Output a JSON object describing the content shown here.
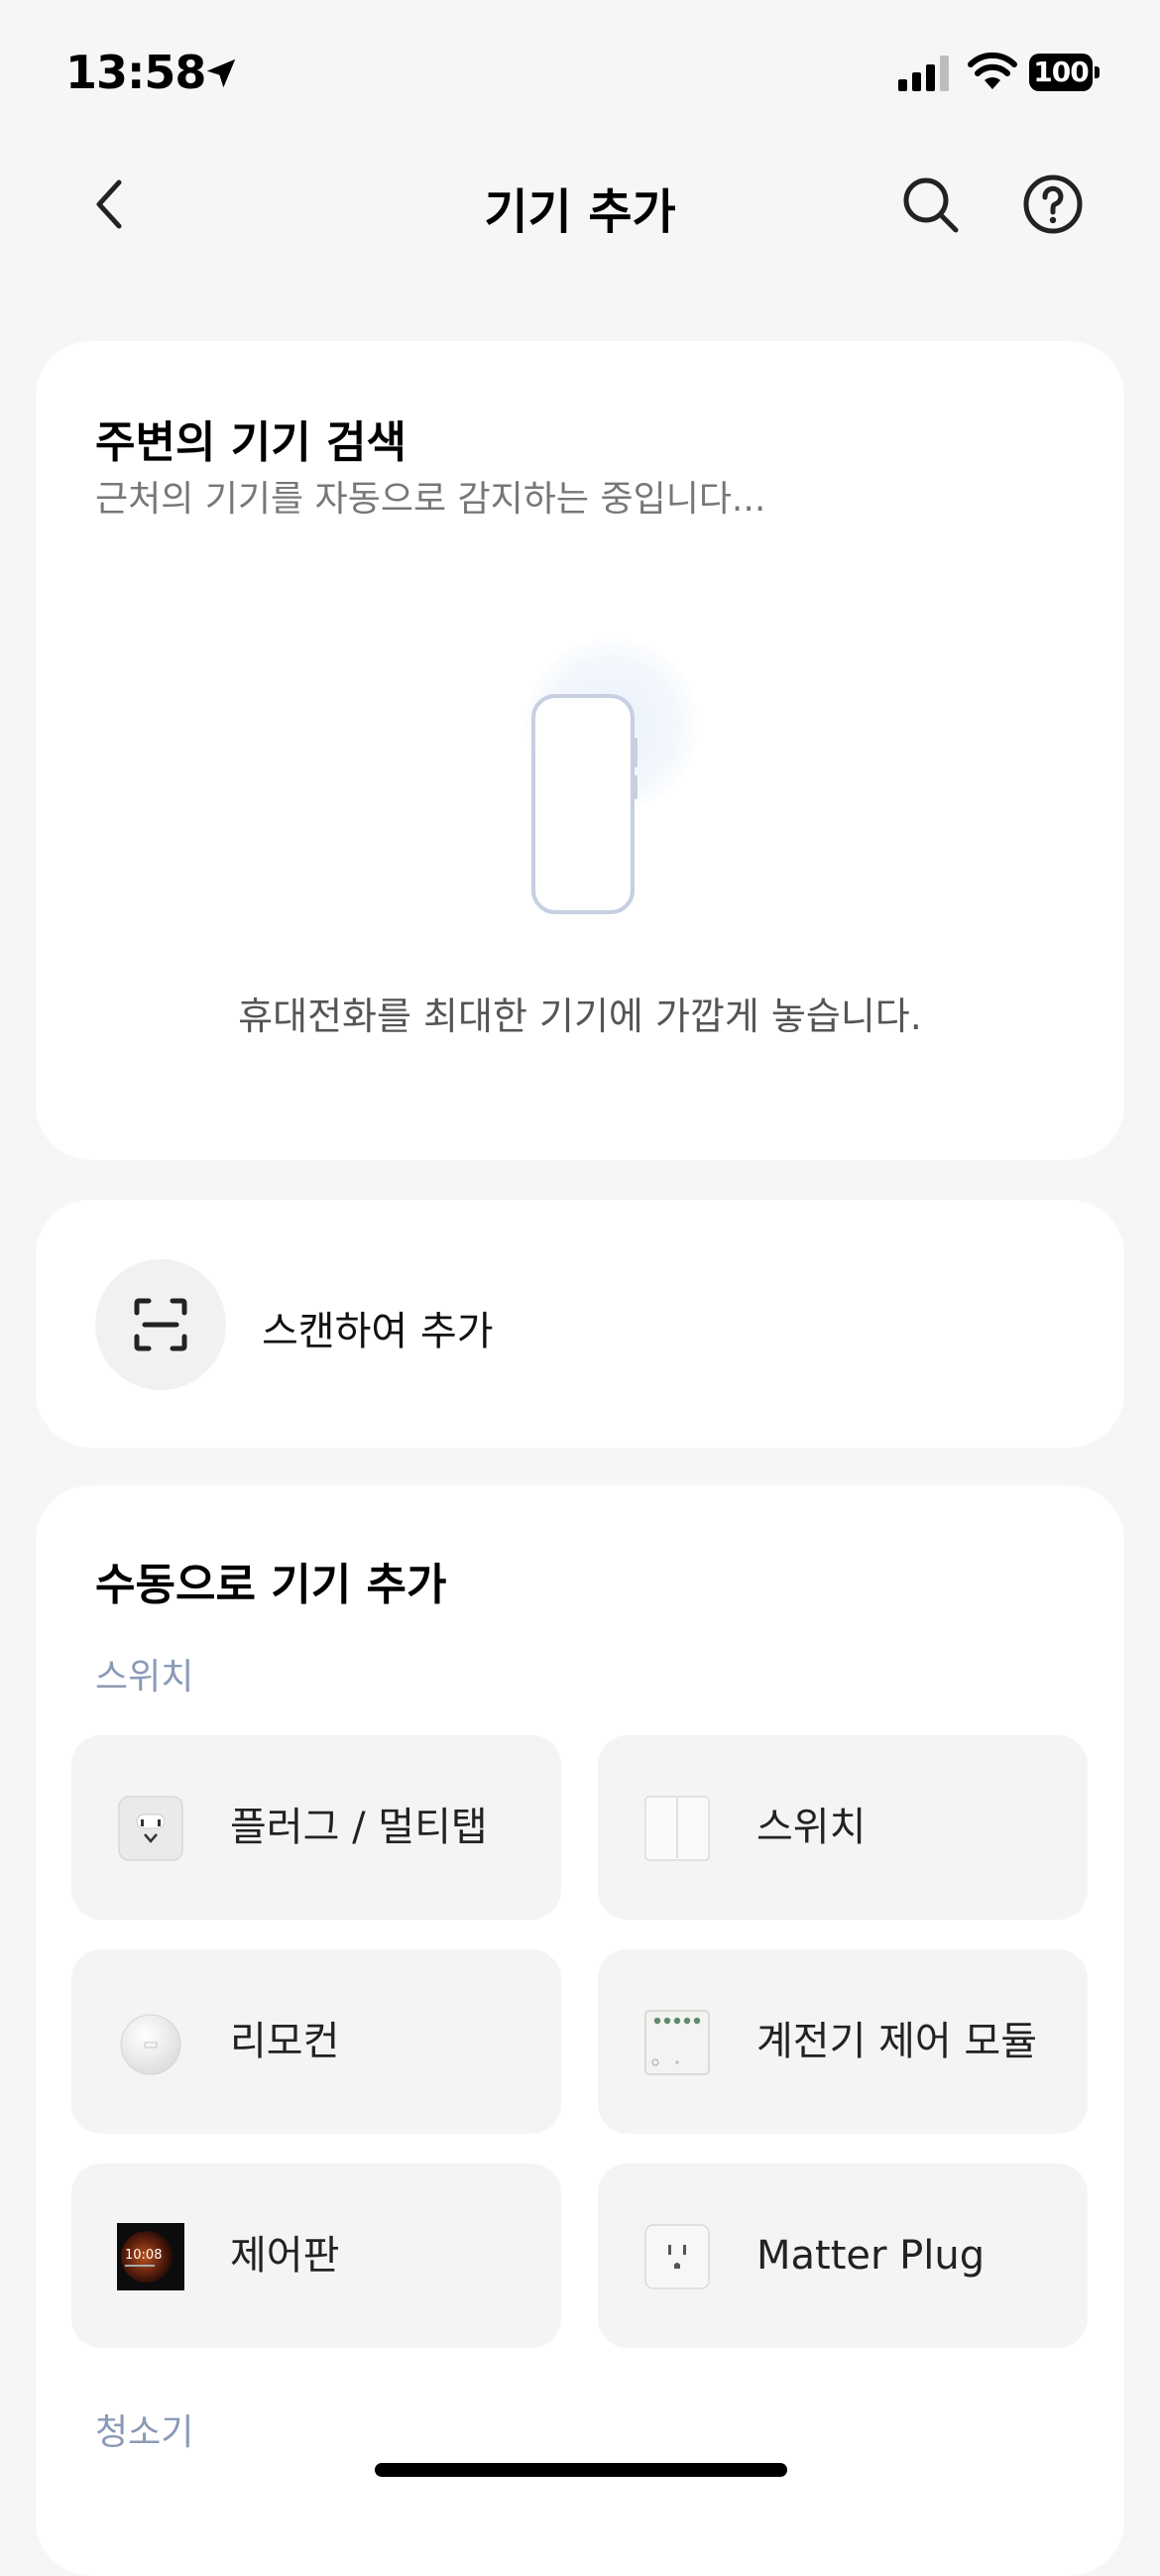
{
  "status_bar": {
    "time": "13:58",
    "battery": "100"
  },
  "nav": {
    "title": "기기 추가"
  },
  "nearby": {
    "title": "주변의 기기 검색",
    "subtitle": "근처의 기기를 자동으로 감지하는 중입니다...",
    "hint": "휴대전화를 최대한 기기에 가깝게 놓습니다."
  },
  "scan": {
    "label": "스캔하여 추가"
  },
  "manual": {
    "title": "수동으로 기기 추가",
    "sections": [
      {
        "label": "스위치",
        "items": [
          {
            "label": "플러그 / 멀티탭",
            "icon": "plug-icon"
          },
          {
            "label": "스위치",
            "icon": "switch-icon"
          },
          {
            "label": "리모컨",
            "icon": "remote-icon"
          },
          {
            "label": "계전기 제어 모듈",
            "icon": "relay-module-icon"
          },
          {
            "label": "제어판",
            "icon": "control-panel-icon",
            "screen_text": "10:08"
          },
          {
            "label": "Matter Plug",
            "icon": "matter-plug-icon"
          }
        ]
      },
      {
        "label": "청소기",
        "items": []
      }
    ]
  },
  "colors": {
    "background": "#f6f6f6",
    "card": "#ffffff",
    "tile": "#f4f4f4",
    "section_label": "#8a9ab7",
    "phone_outline": "#c7cfe1"
  }
}
